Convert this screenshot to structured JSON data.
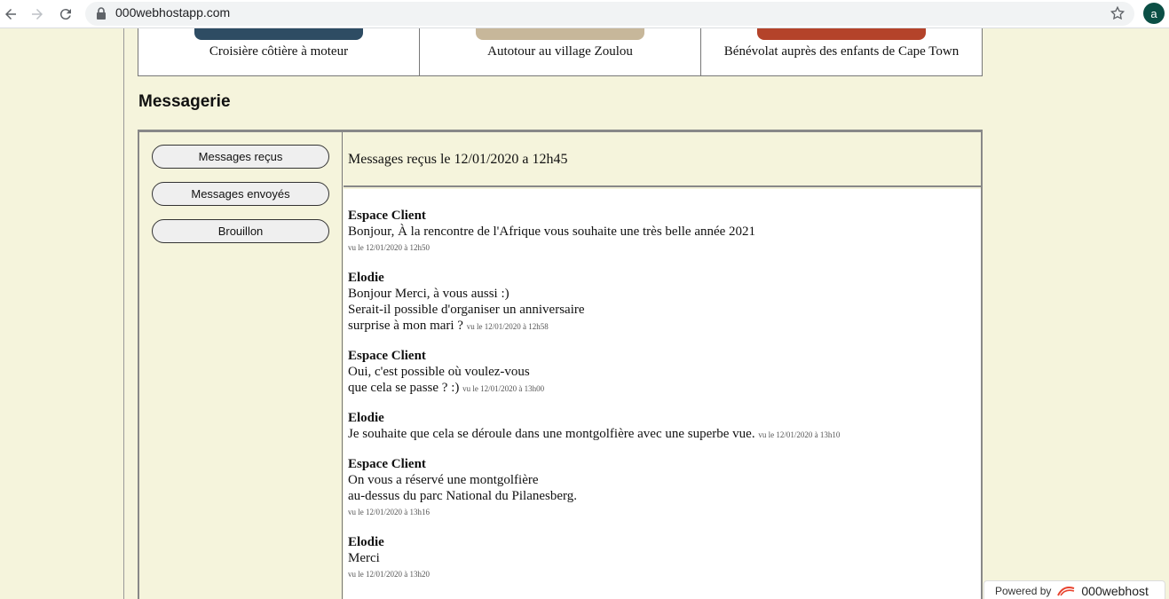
{
  "browser": {
    "url": "000webhostapp.com",
    "profile_initial": "a"
  },
  "cards": [
    {
      "label": "Croisière côtière à moteur",
      "color": "#2e4c63"
    },
    {
      "label": "Autotour au village Zoulou",
      "color": "#c7b79a"
    },
    {
      "label": "Bénévolat auprès des enfants de Cape Town",
      "color": "#b4432a"
    }
  ],
  "section_title": "Messagerie",
  "sidebar": {
    "buttons": [
      "Messages reçus",
      "Messages envoyés",
      "Brouillon"
    ]
  },
  "inbox_header": "Messages reçus le 12/01/2020 a 12h45",
  "messages": [
    {
      "author": "Espace Client",
      "lines": [
        "Bonjour, À la rencontre de l'Afrique vous souhaite une très belle année 2021"
      ],
      "seen": "vu le 12/01/2020 à 12h50"
    },
    {
      "author": "Elodie",
      "lines": [
        "Bonjour Merci, à vous aussi :)",
        "Serait-il possible d'organiser un anniversaire",
        "surprise à mon mari ?"
      ],
      "seen": "vu le 12/01/2020 à 12h58"
    },
    {
      "author": "Espace Client",
      "lines": [
        "Oui, c'est possible où voulez-vous",
        "que cela se passe ? :)"
      ],
      "seen": "vu le 12/01/2020 à 13h00"
    },
    {
      "author": "Elodie",
      "lines": [
        "Je souhaite que cela se déroule dans une montgolfière avec une superbe vue."
      ],
      "seen": "vu le 12/01/2020 à 13h10"
    },
    {
      "author": "Espace Client",
      "lines": [
        "On vous a réservé une montgolfière",
        "au-dessus du parc National du Pilanesberg."
      ],
      "seen": "vu le 12/01/2020 à 13h16"
    },
    {
      "author": "Elodie",
      "lines": [
        "Merci"
      ],
      "seen": "vu le 12/01/2020 à 13h20"
    }
  ],
  "badge": {
    "powered": "Powered by",
    "brand": "000webhost"
  }
}
